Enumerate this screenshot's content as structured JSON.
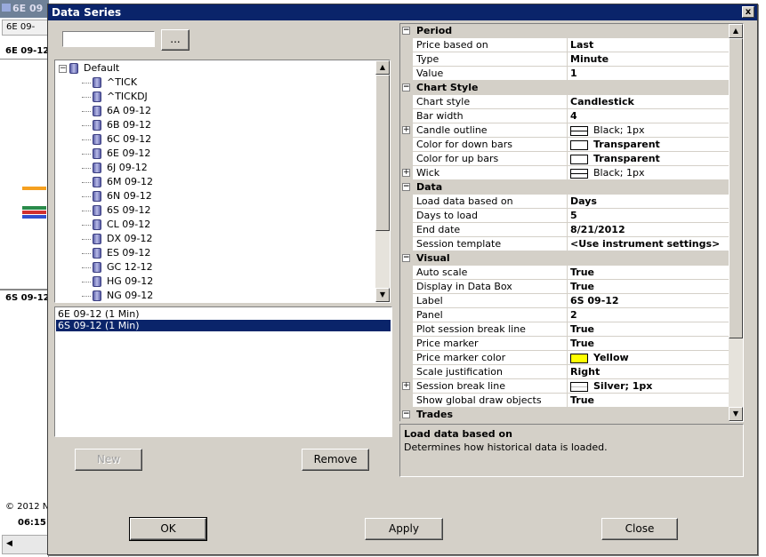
{
  "background": {
    "window_title": "6E 09",
    "tab_label": "6E 09-",
    "chart_label_top": "6E 09-12",
    "chart_label_mid": "6S 09-12",
    "copyright": "© 2012 N",
    "time_label": "06:15"
  },
  "dialog": {
    "title": "Data Series",
    "close_glyph": "x",
    "search": {
      "value": "",
      "browse_label": "..."
    },
    "tree": {
      "root": "Default",
      "items": [
        "^TICK",
        "^TICKDJ",
        "6A 09-12",
        "6B 09-12",
        "6C 09-12",
        "6E 09-12",
        "6J 09-12",
        "6M 09-12",
        "6N 09-12",
        "6S 09-12",
        "CL 09-12",
        "DX 09-12",
        "ES 09-12",
        "GC 12-12",
        "HG 09-12",
        "NG 09-12"
      ]
    },
    "series_list": [
      {
        "label": "6E 09-12 (1 Min)",
        "selected": false
      },
      {
        "label": "6S 09-12 (1 Min)",
        "selected": true
      }
    ],
    "buttons": {
      "new": "New",
      "remove": "Remove",
      "ok": "OK",
      "apply": "Apply",
      "close": "Close"
    },
    "properties": [
      {
        "type": "category",
        "name": "Period"
      },
      {
        "name": "Price based on",
        "value": "Last"
      },
      {
        "name": "Type",
        "value": "Minute"
      },
      {
        "name": "Value",
        "value": "1"
      },
      {
        "type": "category",
        "name": "Chart Style"
      },
      {
        "name": "Chart style",
        "value": "Candlestick"
      },
      {
        "name": "Bar width",
        "value": "4"
      },
      {
        "name": "Candle outline",
        "value": "Black; 1px",
        "expandable": true,
        "swatch": "line",
        "light": true
      },
      {
        "name": "Color for down bars",
        "value": "Transparent",
        "swatch": "#ffffff"
      },
      {
        "name": "Color for up bars",
        "value": "Transparent",
        "swatch": "#ffffff"
      },
      {
        "name": "Wick",
        "value": "Black; 1px",
        "expandable": true,
        "swatch": "line",
        "light": true
      },
      {
        "type": "category",
        "name": "Data"
      },
      {
        "name": "Load data based on",
        "value": "Days",
        "highlight": true
      },
      {
        "name": "Days to load",
        "value": "5"
      },
      {
        "name": "End date",
        "value": "8/21/2012"
      },
      {
        "name": "Session template",
        "value": "<Use instrument settings>"
      },
      {
        "type": "category",
        "name": "Visual"
      },
      {
        "name": "Auto scale",
        "value": "True"
      },
      {
        "name": "Display in Data Box",
        "value": "True"
      },
      {
        "name": "Label",
        "value": "6S 09-12"
      },
      {
        "name": "Panel",
        "value": "2"
      },
      {
        "name": "Plot session break line",
        "value": "True"
      },
      {
        "name": "Price marker",
        "value": "True"
      },
      {
        "name": "Price marker color",
        "value": "Yellow",
        "swatch": "#ffff00"
      },
      {
        "name": "Scale justification",
        "value": "Right"
      },
      {
        "name": "Session break line",
        "value": "Silver; 1px",
        "expandable": true,
        "swatch": "silverline"
      },
      {
        "name": "Show global draw objects",
        "value": "True"
      },
      {
        "type": "category",
        "name": "Trades"
      }
    ],
    "description": {
      "title": "Load data based on",
      "text": "Determines how historical data is loaded."
    },
    "colors": {
      "titlebar": "#0a246a",
      "face": "#d4d0c8",
      "selection": "#0a246a"
    }
  }
}
